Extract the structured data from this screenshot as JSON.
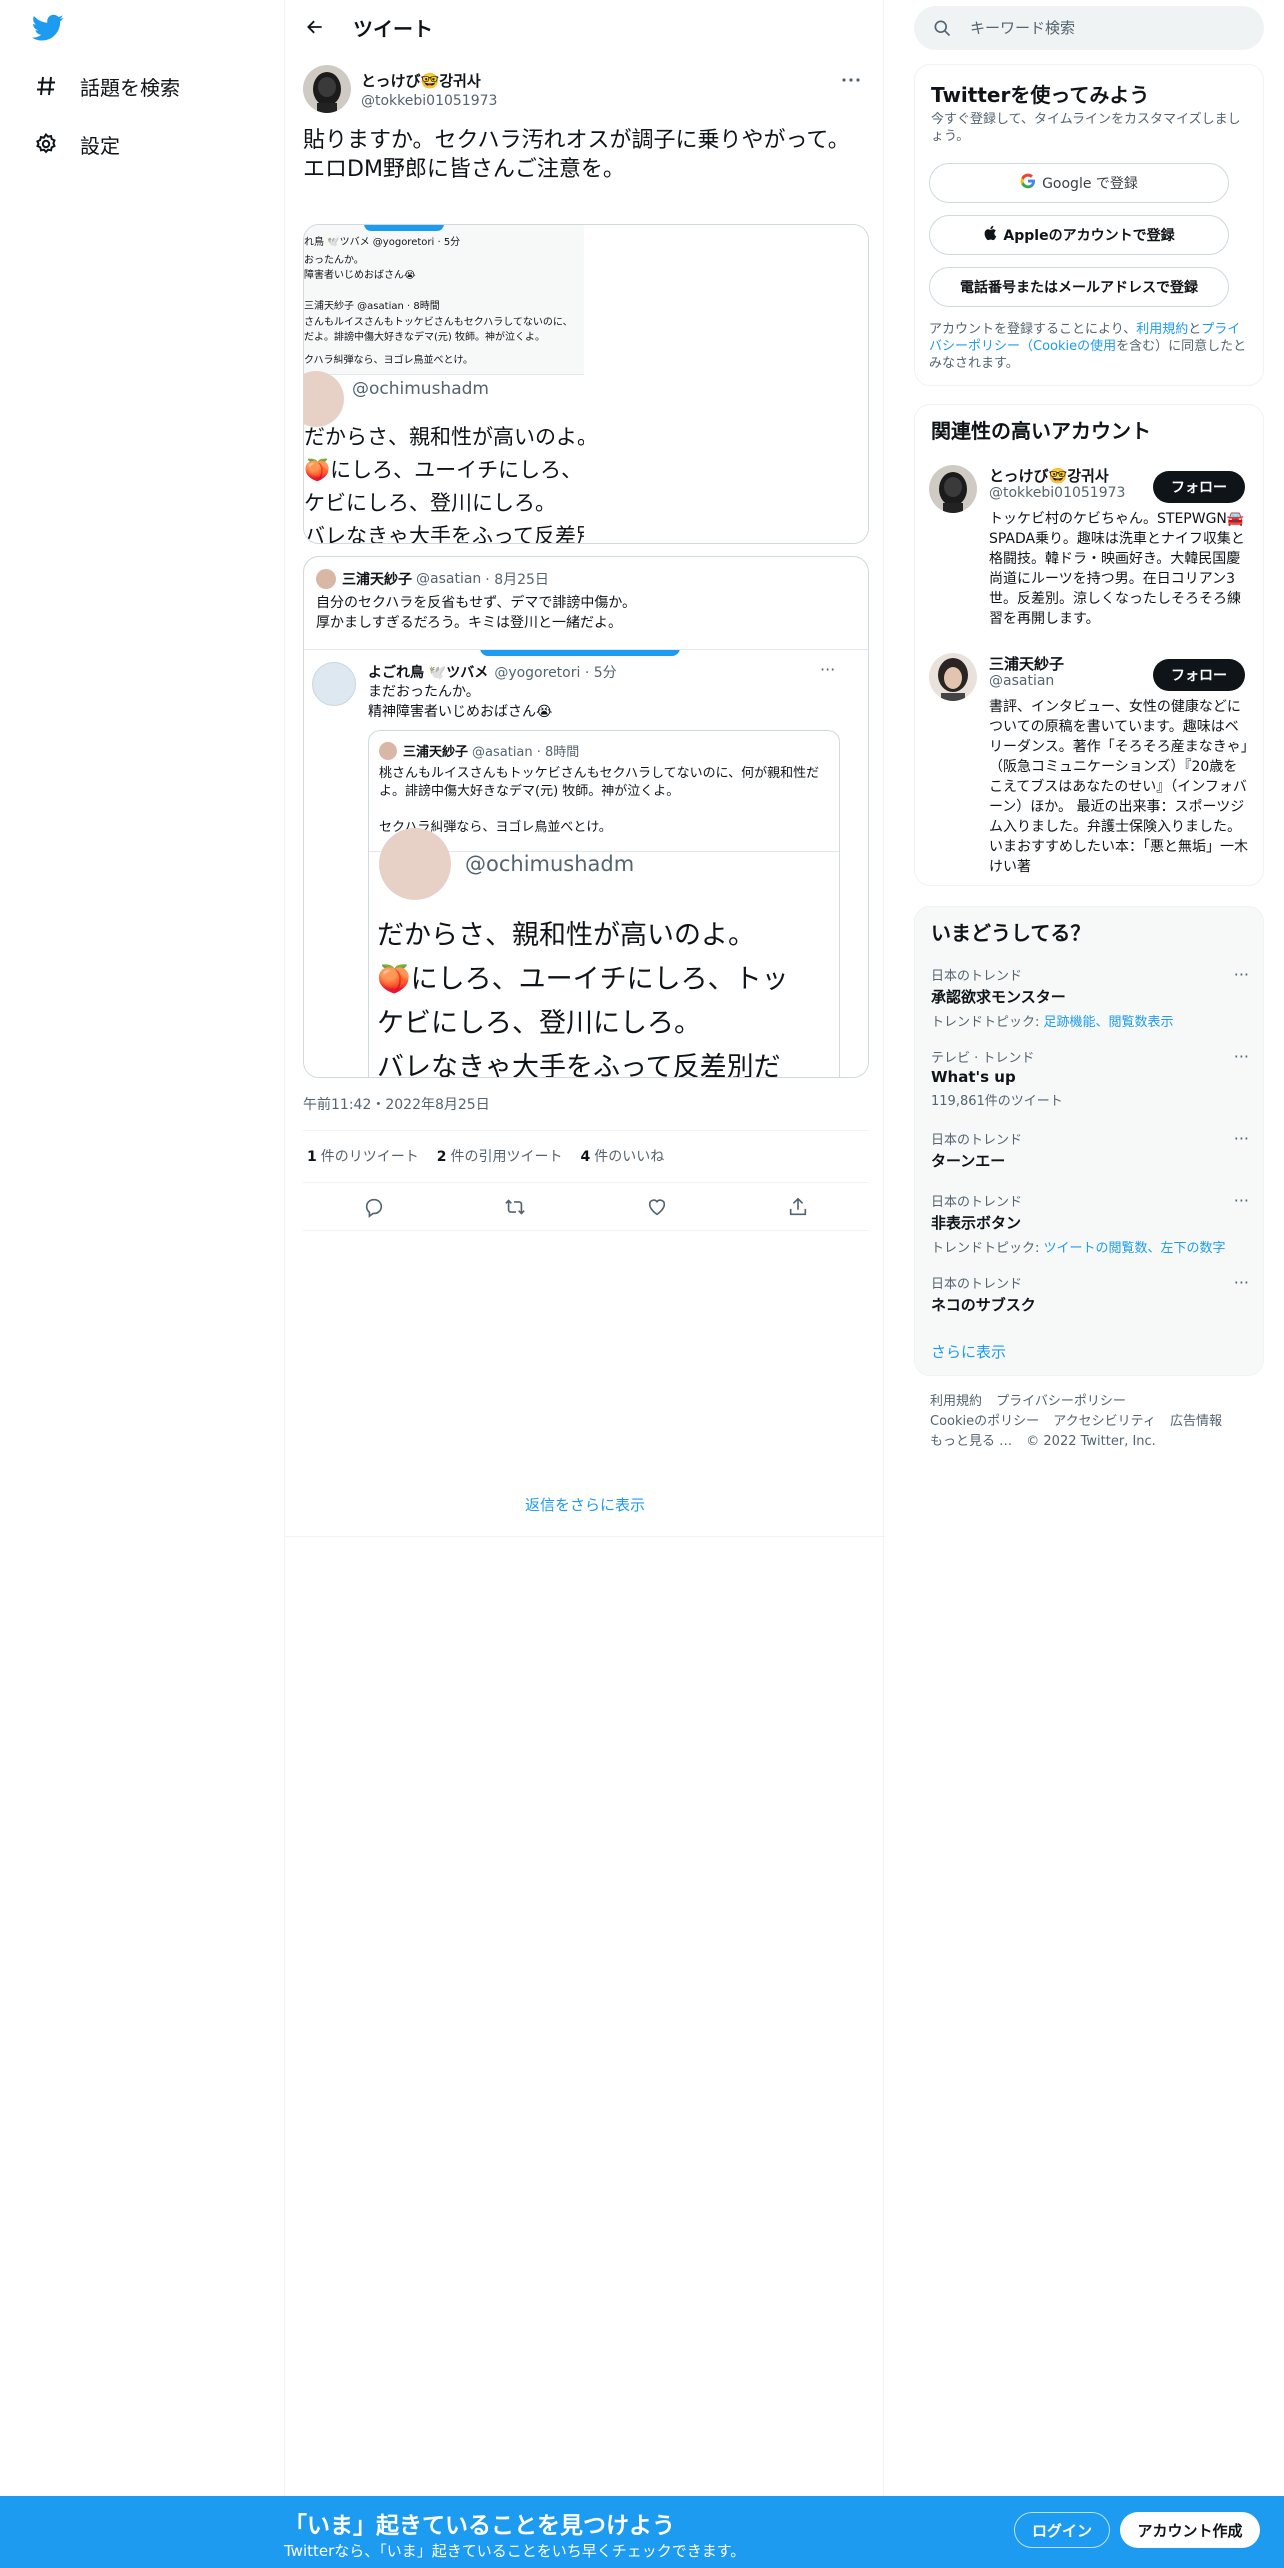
{
  "nav": {
    "logo_icon": "twitter-bird-icon",
    "items": [
      {
        "label": "話題を検索",
        "icon": "hashtag-icon"
      },
      {
        "label": "設定",
        "icon": "gear-icon"
      }
    ]
  },
  "header": {
    "title": "ツイート"
  },
  "tweet": {
    "author_name": "とっけび🤓강귀사",
    "author_handle": "@tokkebi01051973",
    "text": "貼りますか。セクハラ汚れオスが調子に乗りやがって。\nエロDM野郎に皆さんご注意を。",
    "media": {
      "small_lines": [
        "れ鳥 🕊️ツバメ @yogoretori · 5分",
        "おったんか。",
        "障害者いじめおばさん😭",
        "三浦天紗子 @asatian · 8時間",
        "さんもルイスさんもトッケビさんもセクハラしてないのに、",
        "だよ。誹謗中傷大好きなデマ(元) 牧師。神が泣くよ。",
        "クハラ糾弾なら、ヨゴレ鳥並べとけ。"
      ],
      "big_handle": "@ochimushadm",
      "big_text": "だからさ、親和性が高いのよ。\n🍑にしろ、ユーイチにしろ、ト\nケビにしろ、登川にしろ。\nバレなきゃ大手をふって反差別"
    },
    "quote": {
      "name": "三浦天紗子",
      "handle": "@asatian",
      "date": "· 8月25日",
      "text": "自分のセクハラを反省もせず、デマで誹謗中傷か。\n厚かましすぎるだろう。キミは登川と一緒だよ。",
      "media": {
        "name": "よごれ鳥 🕊️ツバメ",
        "handle": "@yogoretori · 5分",
        "text": "まだおったんか。\n精神障害者いじめおばさん😭",
        "inner": {
          "name": "三浦天紗子",
          "handle": "@asatian · 8時間",
          "text": "桃さんもルイスさんもトッケビさんもセクハラしてないのに、何が親和性だよ。誹謗中傷大好きなデマ(元) 牧師。神が泣くよ。\n\nセクハラ糾弾なら、ヨゴレ鳥並べとけ。",
          "big_handle": "@ochimushadm",
          "big_text": "だからさ、親和性が高いのよ。\n🍑にしろ、ユーイチにしろ、トッ\nケビにしろ、登川にしろ。\nバレなきゃ大手をふって反差別だ"
        }
      }
    },
    "time": "午前11:42・2022年8月25日",
    "stats": [
      {
        "count": "1",
        "label": "件のリツイート"
      },
      {
        "count": "2",
        "label": "件の引用ツイート"
      },
      {
        "count": "4",
        "label": "件のいいね"
      }
    ],
    "action_icons": [
      "reply-icon",
      "retweet-icon",
      "like-icon",
      "share-icon"
    ]
  },
  "more_replies": "返信をさらに表示",
  "search": {
    "placeholder": "キーワード検索"
  },
  "signup": {
    "title": "Twitterを使ってみよう",
    "subtitle": "今すぐ登録して、タイムラインをカスタマイズしましょう。",
    "google": "Google で登録",
    "apple": "Appleのアカウントで登録",
    "phone": "電話番号またはメールアドレスで登録",
    "terms_prefix": "アカウントを登録することにより、",
    "terms_link1": "利用規約",
    "terms_and": "と",
    "terms_link2": "プライバシーポリシー（Cookieの使用",
    "terms_suffix": "を含む）に同意したとみなされます。"
  },
  "related": {
    "title": "関連性の高いアカウント",
    "accounts": [
      {
        "name": "とっけび🤓강귀사",
        "handle": "@tokkebi01051973",
        "follow": "フォロー",
        "bio": "トッケビ村のケビちゃん。STEPWGN🚘SPADA乗り。趣味は洗車とナイフ収集と格闘技。韓ドラ・映画好き。大韓民国慶尚道にルーツを持つ男。在日コリアン3世。反差別。涼しくなったしそろそろ練習を再開します。"
      },
      {
        "name": "三浦天紗子",
        "handle": "@asatian",
        "follow": "フォロー",
        "bio": "書評、インタビュー、女性の健康などについての原稿を書いています。趣味はベリーダンス。著作「そろそろ産まなきゃ」（阪急コミュニケーションズ）『20歳をこえてブスはあなたのせい』（インフォバーン）ほか。 最近の出来事：スポーツジム入りました。弁護士保険入りました。 いまおすすめしたい本：「悪と無垢」一木けい著"
      }
    ]
  },
  "trends": {
    "title": "いまどうしてる？",
    "items": [
      {
        "meta": "日本のトレンド",
        "name": "承認欲求モンスター",
        "sub_prefix": "トレンドトピック: ",
        "sub_link": "足跡機能、閲覧数表示"
      },
      {
        "meta": "テレビ · トレンド",
        "name": "What's up",
        "sub_prefix": "119,861件のツイート",
        "sub_link": ""
      },
      {
        "meta": "日本のトレンド",
        "name": "ターンエー",
        "sub_prefix": "",
        "sub_link": ""
      },
      {
        "meta": "日本のトレンド",
        "name": "非表示ボタン",
        "sub_prefix": "トレンドトピック: ",
        "sub_link": "ツイートの閲覧数、左下の数字"
      },
      {
        "meta": "日本のトレンド",
        "name": "ネコのサブスク",
        "sub_prefix": "",
        "sub_link": ""
      }
    ],
    "show_more": "さらに表示"
  },
  "footer": {
    "links": [
      "利用規約",
      "プライバシーポリシー",
      "Cookieのポリシー",
      "アクセシビリティ",
      "広告情報",
      "もっと見る …",
      "© 2022 Twitter, Inc."
    ]
  },
  "bottom_bar": {
    "title": "「いま」起きていることを見つけよう",
    "subtitle": "Twitterなら、「いま」起きていることをいち早くチェックできます。",
    "login": "ログイン",
    "signup": "アカウント作成"
  },
  "colors": {
    "accent": "#1d9bf0",
    "text": "#0f1419",
    "muted": "#536471"
  }
}
